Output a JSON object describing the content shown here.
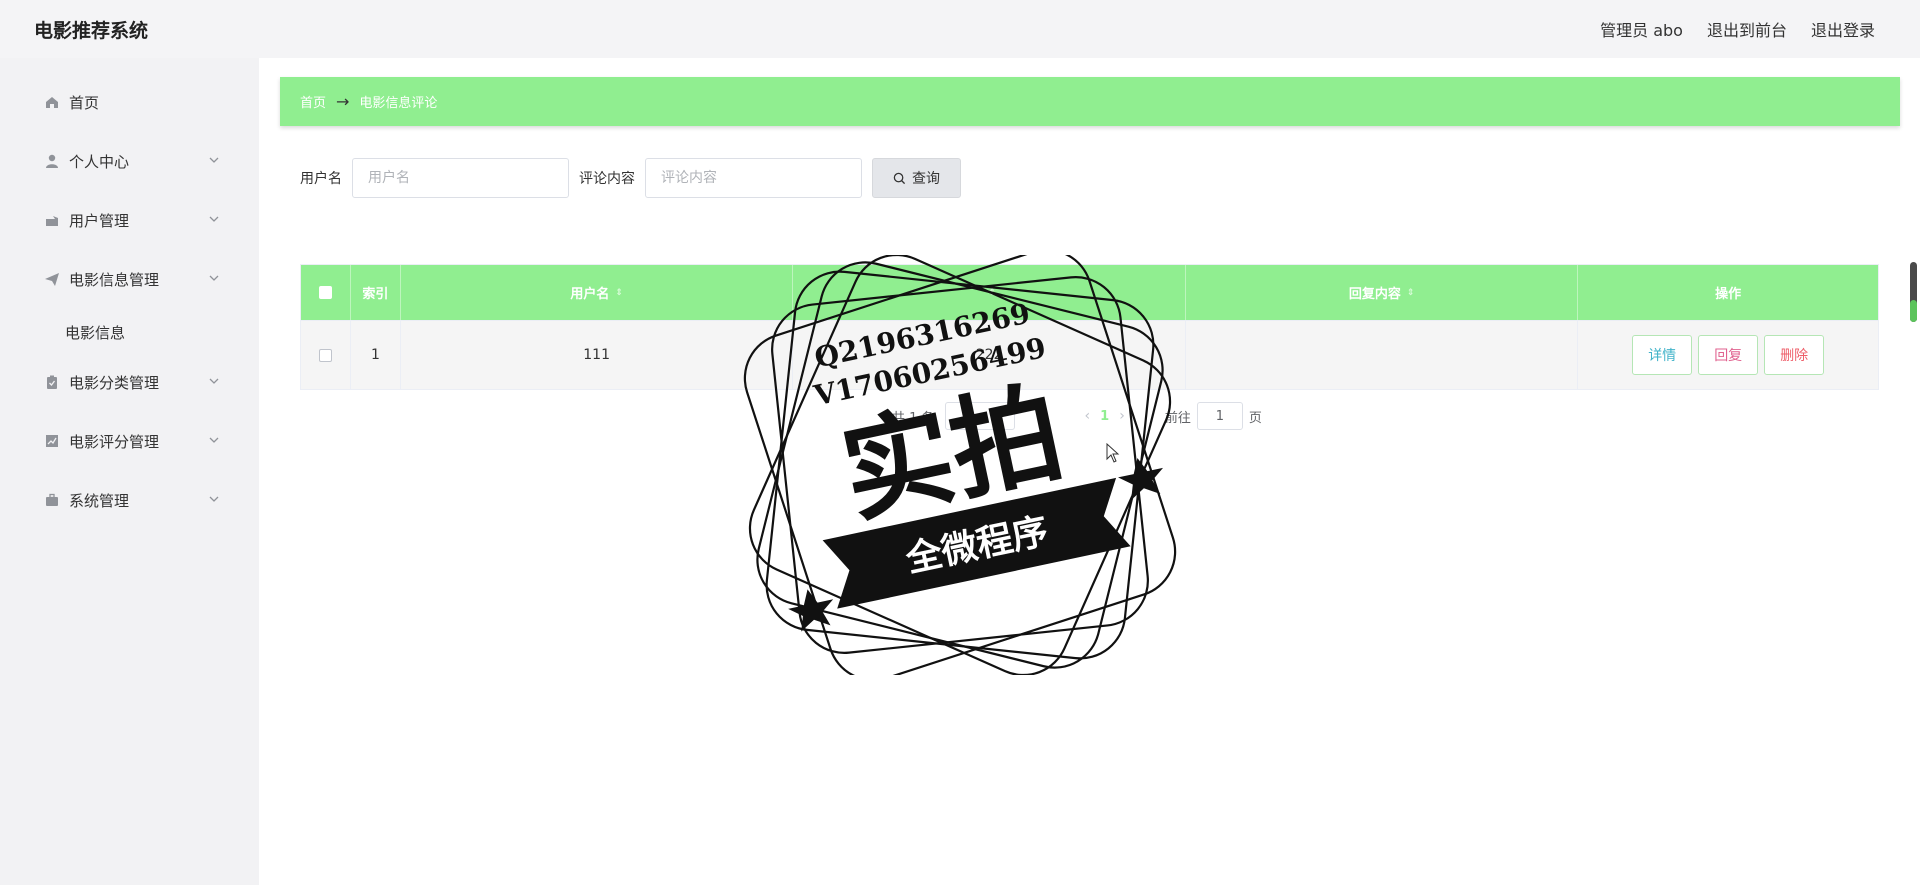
{
  "app": {
    "title": "电影推荐系统"
  },
  "topbar": {
    "user_label": "管理员 abo",
    "to_front": "退出到前台",
    "logout": "退出登录"
  },
  "sidebar": {
    "items": [
      {
        "label": "首页",
        "icon": "home-icon"
      },
      {
        "label": "个人中心",
        "icon": "user-icon"
      },
      {
        "label": "用户管理",
        "icon": "user-manage-icon"
      },
      {
        "label": "电影信息管理",
        "icon": "send-icon"
      },
      {
        "label": "电影分类管理",
        "icon": "clipboard-icon"
      },
      {
        "label": "电影评分管理",
        "icon": "chart-icon"
      },
      {
        "label": "系统管理",
        "icon": "briefcase-icon"
      }
    ],
    "sub_item": "电影信息"
  },
  "breadcrumb": {
    "home": "首页",
    "arrow": "→",
    "current": "电影信息评论"
  },
  "search": {
    "username_label": "用户名",
    "username_placeholder": "用户名",
    "comment_label": "评论内容",
    "comment_placeholder": "评论内容",
    "query_label": "查询"
  },
  "table": {
    "headers": {
      "index": "索引",
      "username": "用户名",
      "comment": "",
      "reply": "回复内容",
      "ops": "操作"
    },
    "rows": [
      {
        "index": "1",
        "username": "111",
        "comment": "222",
        "reply": ""
      }
    ],
    "ops": {
      "detail": "详情",
      "reply": "回复",
      "delete": "删除"
    }
  },
  "pagination": {
    "total": "共 1 条",
    "page": "1",
    "goto_label": "前往",
    "goto_value": "1",
    "page_suffix": "页"
  },
  "watermark": {
    "line1": "Q2196316269",
    "line2": "V17060256499",
    "main": "实拍",
    "banner": "全微程序"
  },
  "colors": {
    "accent": "#90ee90",
    "detail": "#41b3c9",
    "reply": "#e0628f",
    "delete": "#ee5f6a"
  }
}
